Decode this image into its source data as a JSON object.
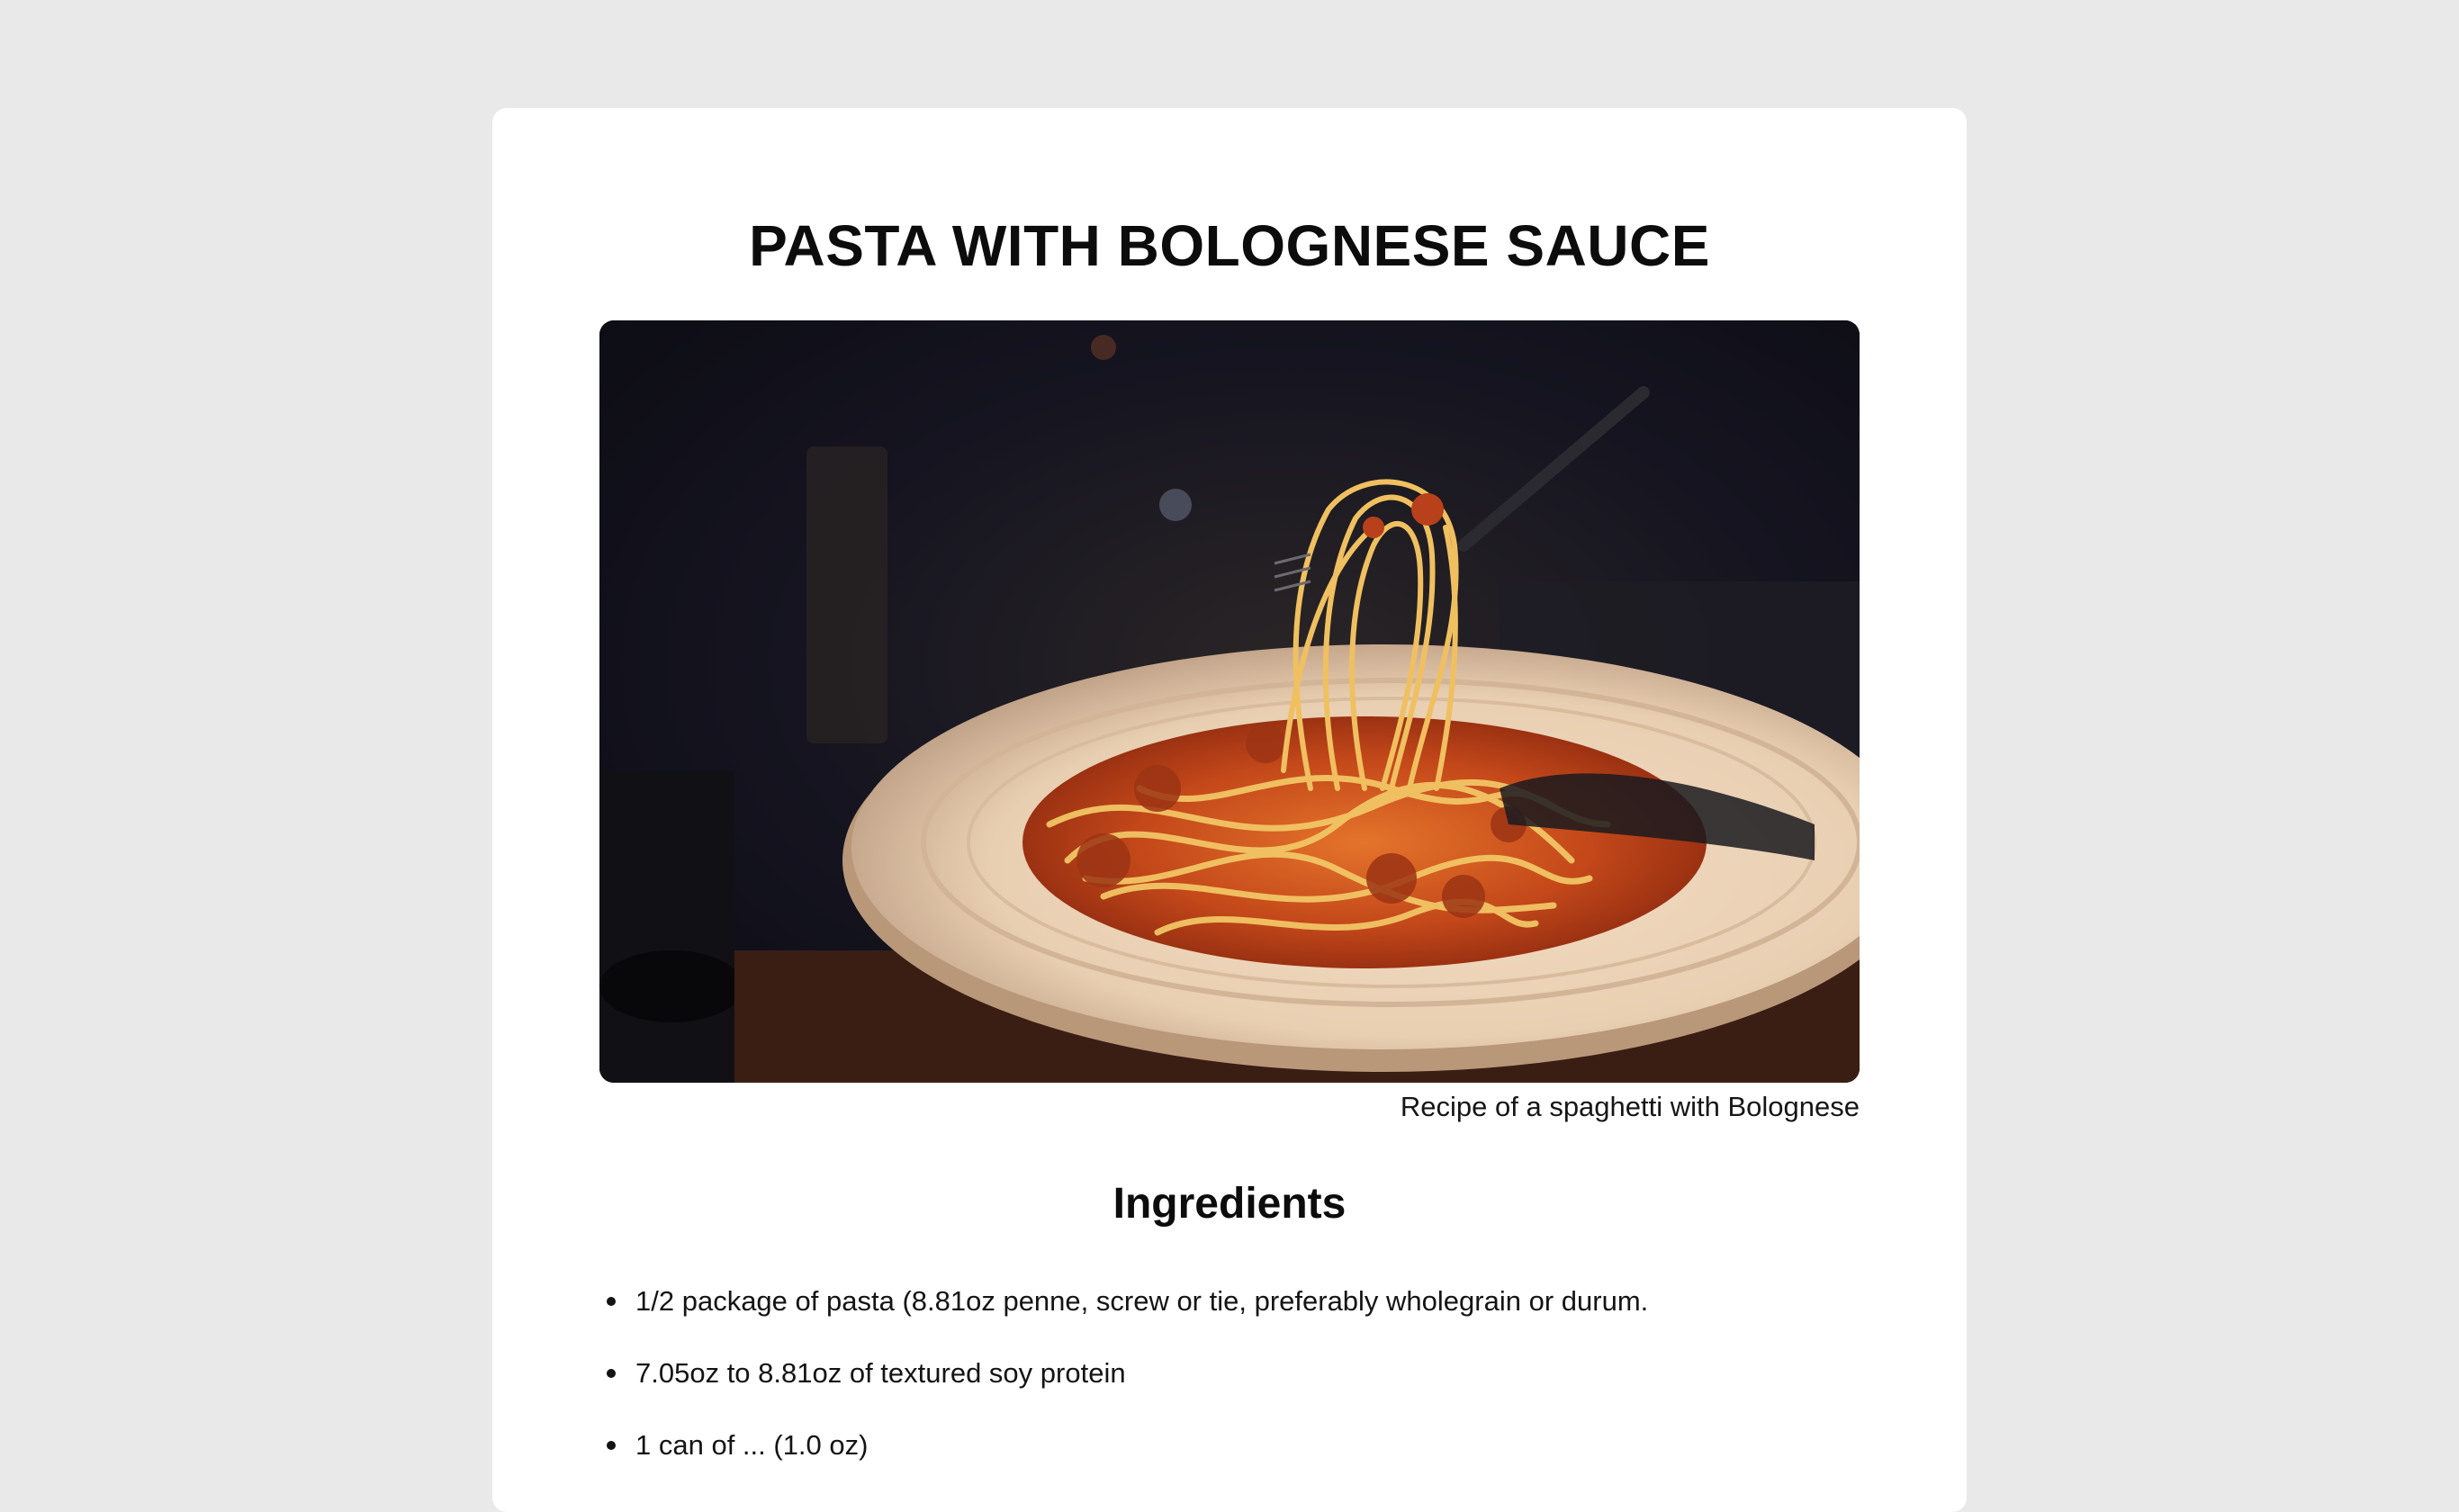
{
  "recipe": {
    "title": "PASTA WITH BOLOGNESE SAUCE",
    "image_caption": "Recipe of a spaghetti with Bolognese",
    "ingredients_heading": "Ingredients",
    "ingredients": [
      "1/2 package of pasta (8.81oz penne, screw or tie, preferably wholegrain or durum.",
      "7.05oz to 8.81oz of textured soy protein",
      "1 can of ... (1.0 oz)"
    ]
  },
  "colors": {
    "page_background": "#e9e9e9",
    "card_background": "#ffffff",
    "text": "#111111"
  }
}
